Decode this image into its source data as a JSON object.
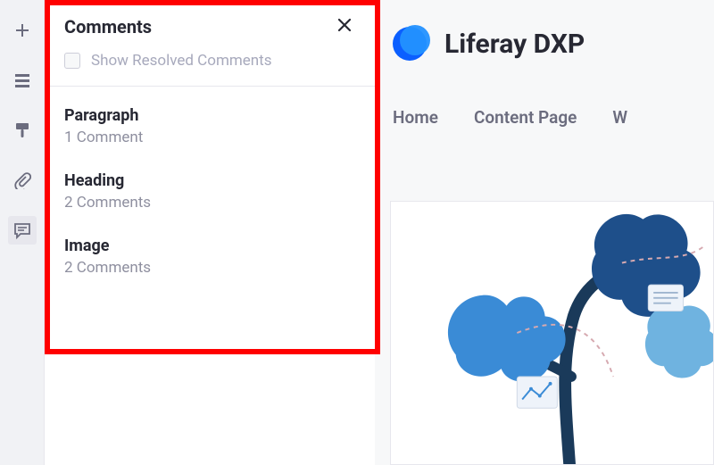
{
  "rail": {
    "items": [
      {
        "name": "add-icon"
      },
      {
        "name": "layout-icon"
      },
      {
        "name": "brush-icon"
      },
      {
        "name": "attach-icon"
      },
      {
        "name": "comments-icon"
      }
    ]
  },
  "panel": {
    "title": "Comments",
    "show_resolved_label": "Show Resolved Comments",
    "items": [
      {
        "title": "Paragraph",
        "sub": "1 Comment"
      },
      {
        "title": "Heading",
        "sub": "2 Comments"
      },
      {
        "title": "Image",
        "sub": "2 Comments"
      }
    ]
  },
  "brand": {
    "title": "Liferay DXP"
  },
  "nav": {
    "items": [
      "Home",
      "Content Page",
      "W"
    ]
  }
}
